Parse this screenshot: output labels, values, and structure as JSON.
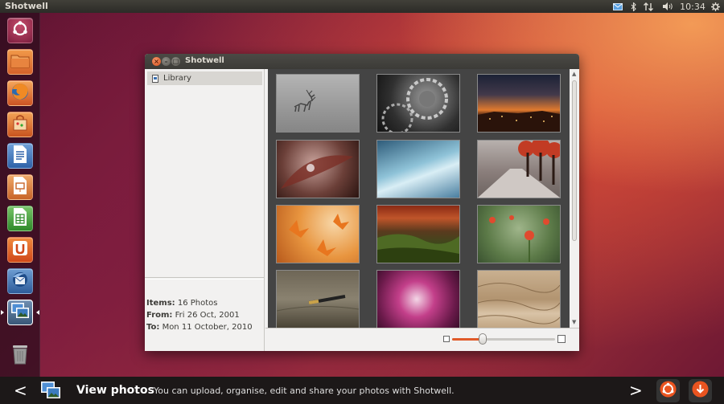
{
  "topbar": {
    "app_title": "Shotwell",
    "clock": "10:34",
    "icons": [
      "mail-icon",
      "bluetooth-icon",
      "network-icon",
      "volume-icon",
      "system-gear-icon"
    ]
  },
  "launcher": {
    "items": [
      {
        "name": "dash-home",
        "icon": "ubuntu-logo-icon"
      },
      {
        "name": "files",
        "icon": "folder-icon"
      },
      {
        "name": "firefox",
        "icon": "firefox-icon"
      },
      {
        "name": "software-center",
        "icon": "shopping-bag-icon"
      },
      {
        "name": "libreoffice-writer",
        "icon": "writer-icon"
      },
      {
        "name": "libreoffice-impress",
        "icon": "impress-icon"
      },
      {
        "name": "libreoffice-calc",
        "icon": "calc-icon"
      },
      {
        "name": "ubuntu-one",
        "icon": "ubuntu-one-icon"
      },
      {
        "name": "thunderbird",
        "icon": "thunderbird-icon"
      },
      {
        "name": "shotwell",
        "icon": "shotwell-icon",
        "active": true
      },
      {
        "name": "trash",
        "icon": "trash-icon"
      }
    ]
  },
  "window": {
    "title": "Shotwell",
    "sidebar": {
      "library_label": "Library",
      "stats": {
        "items_label": "Items:",
        "items_value": "16 Photos",
        "from_label": "From:",
        "from_value": "Fri 26 Oct, 2001",
        "to_label": "To:",
        "to_value": "Mon 11 October, 2010"
      }
    },
    "photos": [
      {
        "name": "misty-deer"
      },
      {
        "name": "clock-gears"
      },
      {
        "name": "city-sunset"
      },
      {
        "name": "water-droplet-leaf"
      },
      {
        "name": "blue-abstract"
      },
      {
        "name": "autumn-path"
      },
      {
        "name": "orange-leaves"
      },
      {
        "name": "green-valley"
      },
      {
        "name": "red-poppies"
      },
      {
        "name": "fountain-pen"
      },
      {
        "name": "pink-flower"
      },
      {
        "name": "sand-dunes"
      }
    ],
    "zoom": {
      "level": 0.3
    }
  },
  "bottom_bar": {
    "title": "View photos",
    "description": "You can upload, organise, edit and share your photos with Shotwell.",
    "prev_label": "<",
    "next_label": ">"
  }
}
